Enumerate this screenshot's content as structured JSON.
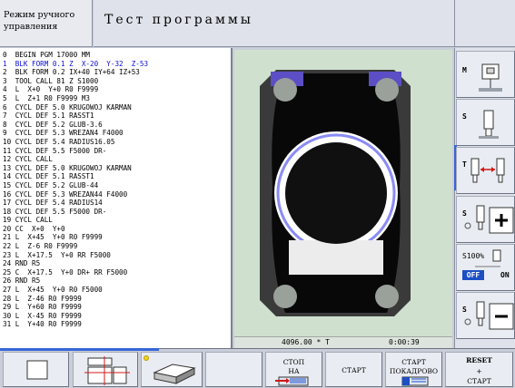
{
  "header": {
    "mode_line1": "Режим ручного",
    "mode_line2": "управления",
    "title": "Тест программы"
  },
  "program": [
    "0  BEGIN PGM 17000 MM",
    "1  BLK FORM 0.1 Z  X-20  Y-32  Z-53",
    "2  BLK FORM 0.2 IX+40 IY+64 IZ+53",
    "3  TOOL CALL 81 Z S1000",
    "4  L  X+0  Y+0 R0 F9999",
    "5  L  Z+1 R0 F9999 M3",
    "6  CYCL DEF 5.0 KRUGOWOJ KARMAN",
    "7  CYCL DEF 5.1 RASST1",
    "8  CYCL DEF 5.2 GLUB-3.6",
    "9  CYCL DEF 5.3 WREZAN4 F4000",
    "10 CYCL DEF 5.4 RADIUS16.05",
    "11 CYCL DEF 5.5 F5000 DR-",
    "12 CYCL CALL",
    "13 CYCL DEF 5.0 KRUGOWOJ KARMAN",
    "14 CYCL DEF 5.1 RASST1",
    "15 CYCL DEF 5.2 GLUB-44",
    "16 CYCL DEF 5.3 WREZAN44 F4000",
    "17 CYCL DEF 5.4 RADIUS14",
    "18 CYCL DEF 5.5 F5000 DR-",
    "19 CYCL CALL",
    "20 CC  X+0  Y+0",
    "21 L  X+45  Y+0 R0 F9999",
    "22 L  Z-6 R0 F9999",
    "23 L  X+17.5  Y+0 RR F5000",
    "24 RND R5",
    "25 C  X+17.5  Y+0 DR+ RR F5000",
    "26 RND R5",
    "27 L  X+45  Y+0 R0 F5000",
    "28 L  Z-46 R0 F9999",
    "29 L  Y+60 R0 F9999",
    "30 L  X-45 R0 F9999",
    "31 L  Y+40 R0 F9999"
  ],
  "current_line": 1,
  "simulation": {
    "time_value": "4096.00 * T",
    "clock": "0:00:39"
  },
  "right_keys": {
    "m_label": "M",
    "s_label": "S",
    "t_label": "T",
    "s3_label": "S",
    "percent": "S100%",
    "off": "OFF",
    "on": "ON",
    "s5_label": "S"
  },
  "bottom_keys": {
    "stop_line1": "СТОП",
    "stop_line2": "НА",
    "start": "СТАРТ",
    "start_block_line1": "СТАРТ",
    "start_block_line2": "ПОКАДРОВО",
    "reset_line1": "RESET",
    "reset_line2": "+",
    "reset_line3": "СТАРТ"
  },
  "colors": {
    "current_line": "#0a0cd8",
    "part": "#101010",
    "pocket_ring": "#8a8cf5",
    "background": "#cfe0cf",
    "accent": "#3566da"
  }
}
